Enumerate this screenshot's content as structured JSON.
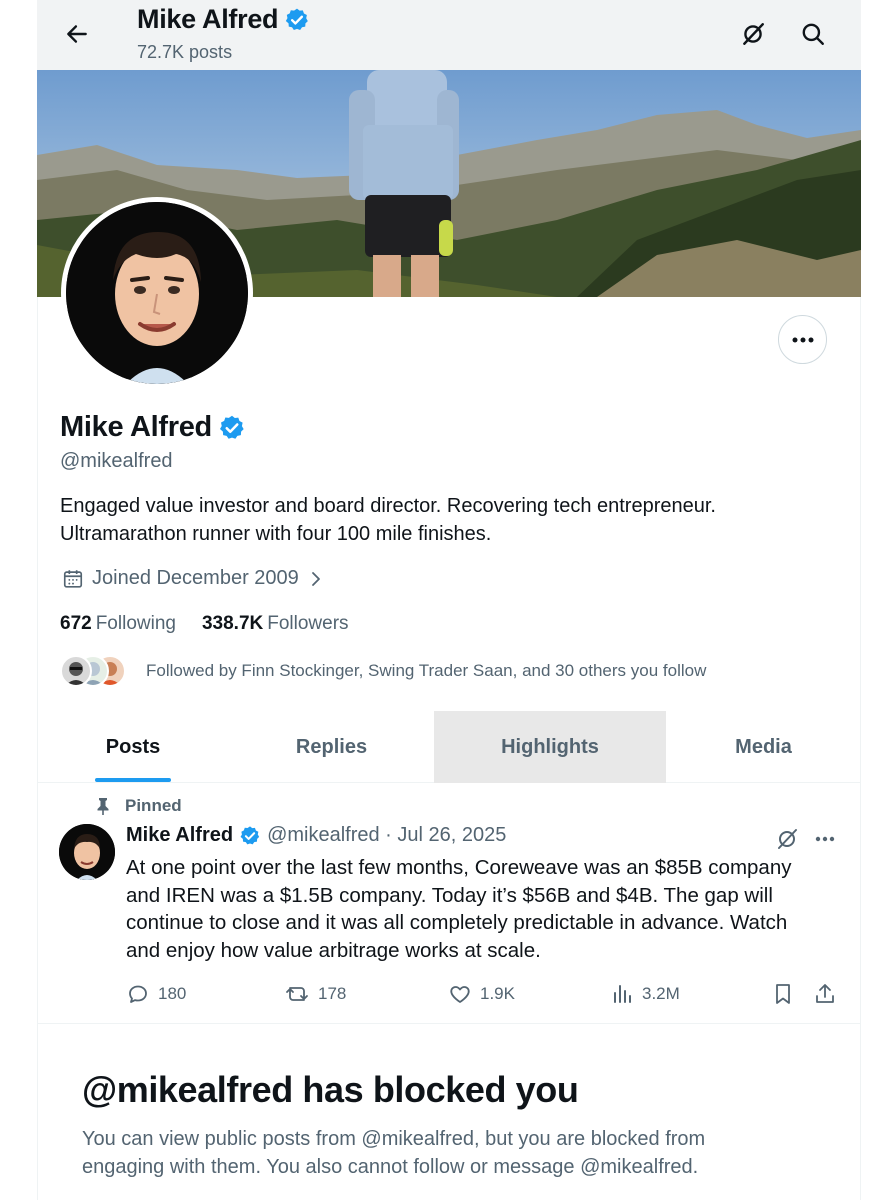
{
  "header": {
    "name": "Mike Alfred",
    "posts_count": "72.7K posts"
  },
  "profile": {
    "name": "Mike Alfred",
    "handle": "@mikealfred",
    "bio_lines": [
      "Engaged value investor and board director. Recovering tech entrepreneur.",
      "Ultramarathon runner with four 100 mile finishes."
    ],
    "joined": "Joined December 2009",
    "following_count": "672",
    "following_label": "Following",
    "followers_count": "338.7K",
    "followers_label": "Followers",
    "followed_by": "Followed by Finn Stockinger, Swing Trader Saan, and 30 others you follow"
  },
  "tabs": [
    {
      "label": "Posts"
    },
    {
      "label": "Replies"
    },
    {
      "label": "Highlights"
    },
    {
      "label": "Media"
    }
  ],
  "pinned_post": {
    "pinned_label": "Pinned",
    "author_name": "Mike Alfred",
    "meta": "@mikealfred · Jul 26, 2025",
    "text_lines": [
      "At one point over the last few months, Coreweave was an $85B company",
      "and IREN was a $1.5B company. Today it’s $56B and $4B. The gap will",
      "continue to close and it was all completely predictable in advance. Watch",
      "and enjoy how value arbitrage works at scale."
    ],
    "replies": "180",
    "reposts": "178",
    "likes": "1.9K",
    "views": "3.2M"
  },
  "blocked": {
    "title": "@mikealfred has blocked you",
    "text_lines": [
      "You can view public posts from @mikealfred, but you are blocked from",
      "engaging with them. You also cannot follow or message @mikealfred."
    ]
  },
  "colors": {
    "accent": "#1d9bf0",
    "text_primary": "#0f1419",
    "text_secondary": "#536471",
    "highlight_tab_bg": "#e8e8e8"
  },
  "icons": [
    "back-arrow-icon",
    "grok-icon",
    "search-icon",
    "verified-badge-icon",
    "more-icon",
    "calendar-icon",
    "chevron-right-icon",
    "pin-icon",
    "reply-icon",
    "repost-icon",
    "like-icon",
    "views-icon",
    "bookmark-icon",
    "share-icon"
  ]
}
